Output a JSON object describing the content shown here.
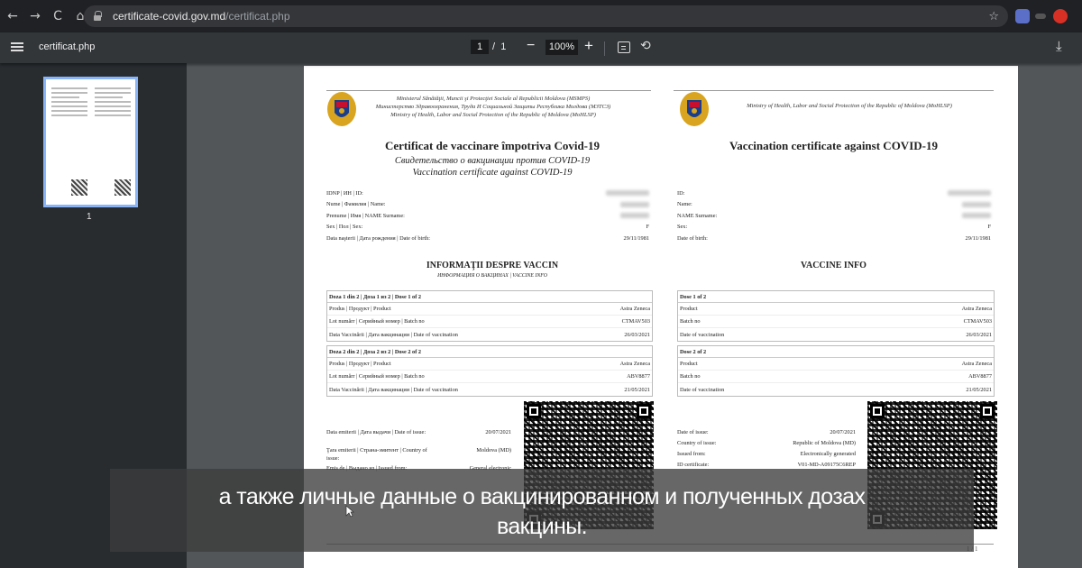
{
  "browser": {
    "url_domain": "certificate-covid.gov.md",
    "url_path": "/certificat.php",
    "back_glyph": "←",
    "forward_glyph": "→",
    "reload_glyph": "C",
    "home_glyph": "⌂",
    "star_glyph": "☆"
  },
  "toolbar": {
    "doc_title": "certificat.php",
    "page_current": "1",
    "page_sep": "/",
    "page_total": "1",
    "zoom_minus": "−",
    "zoom": "100%",
    "zoom_plus": "+",
    "rotate_glyph": "⟲",
    "download_glyph": "⤓"
  },
  "sidebar": {
    "thumb_number": "1"
  },
  "left": {
    "ministry_lines": [
      "Ministerul Sănătăţii, Muncii şi Protecţiei Sociale al Republicii Moldova (MSMPS)",
      "Министерство Здравоохранения, Труда И Социальной Защиты Республика Молдова (МЗТСЗ)",
      "Ministry of Health, Labor and Social Protection of the Republic of Moldova (MoHLSP)"
    ],
    "title": "Certificat de vaccinare împotriva Covid-19",
    "subtitle_ru": "Свидетельство о вакцинации против COVID-19",
    "subtitle_en": "Vaccination certificate against COVID-19",
    "fields": [
      {
        "label": "IDNP | ИН | ID:",
        "value": ""
      },
      {
        "label": "Nume | Фамилия | Name:",
        "value": ""
      },
      {
        "label": "Prenume | Имя | NAME Surname:",
        "value": ""
      },
      {
        "label": "Sex | Пол | Sex:",
        "value": "F"
      },
      {
        "label": "Data naşterii | Дата рождения | Date of birth:",
        "value": "29/11/1981"
      }
    ],
    "vaccine_title": "INFORMAŢII DESPRE VACCIN",
    "vaccine_sub": "ИНФОРМАЦИЯ О ВАКЦИНАХ | VACCINE INFO",
    "dose1_head": "Doza 1 din 2 | Доза 1 из 2 | Dose 1 of 2",
    "dose1_rows": [
      {
        "label": "Produs | Продукт | Product",
        "value": "Astra Zeneca"
      },
      {
        "label": "Lot numărr | Серийный номер | Batch no",
        "value": "CTMAV503"
      },
      {
        "label": "Data Vaccinării | Дата вакцинации | Date of vaccination",
        "value": "26/03/2021"
      }
    ],
    "dose2_head": "Doza 2 din 2 | Доза 2 из 2 | Dose 2 of 2",
    "dose2_rows": [
      {
        "label": "Produs | Продукт | Product",
        "value": "Astra Zeneca"
      },
      {
        "label": "Lot numărr | Серийный номер | Batch no",
        "value": "ABV8877"
      },
      {
        "label": "Data Vaccinării | Дата вакцинации | Date of vaccination",
        "value": "21/05/2021"
      }
    ],
    "issue": [
      {
        "label": "Data emiterii | Дата выдачи | Date of issue:",
        "value": "20/07/2021"
      },
      {
        "label": "Ţara emiterii | Страна-эмитент | Country of issue:",
        "value": "Moldova (MD)"
      },
      {
        "label": "Emis de | Выдано из | Issued from:",
        "value": "General electronic"
      }
    ]
  },
  "right": {
    "ministry": "Ministry of Health, Labor and Social Protection of the Republic of Moldova (MoHLSP)",
    "title": "Vaccination certificate against COVID-19",
    "fields": [
      {
        "label": "ID:",
        "value": ""
      },
      {
        "label": "Name:",
        "value": ""
      },
      {
        "label": "NAME Surname:",
        "value": ""
      },
      {
        "label": "Sex:",
        "value": "F"
      },
      {
        "label": "Date of birth:",
        "value": "29/11/1981"
      }
    ],
    "vaccine_title": "VACCINE INFO",
    "dose1_head": "Dose 1 of 2",
    "dose1_rows": [
      {
        "label": "Product",
        "value": "Astra Zeneca"
      },
      {
        "label": "Batch no",
        "value": "CTMAV503"
      },
      {
        "label": "Date of vaccination",
        "value": "26/03/2021"
      }
    ],
    "dose2_head": "Dose 2 of 2",
    "dose2_rows": [
      {
        "label": "Product",
        "value": "Astra Zeneca"
      },
      {
        "label": "Batch no",
        "value": "ABV8877"
      },
      {
        "label": "Date of vaccination",
        "value": "21/05/2021"
      }
    ],
    "issue": [
      {
        "label": "Date of issue:",
        "value": "20/07/2021"
      },
      {
        "label": "Country of issue:",
        "value": "Republic of Moldova (MD)"
      },
      {
        "label": "Issued from:",
        "value": "Electronically generated"
      },
      {
        "label": "ID certificate:",
        "value": "V01-MD-A09175C6REP"
      }
    ]
  },
  "page_footer": "1 / 1",
  "subtitle": {
    "line1": "а также личные данные о вакцинированном и полученных дозах",
    "line2": "вакцины."
  },
  "colors": {
    "toolbar_bg": "#323639",
    "browser_bg": "#202124",
    "thumb_border": "#8ab4f8"
  }
}
